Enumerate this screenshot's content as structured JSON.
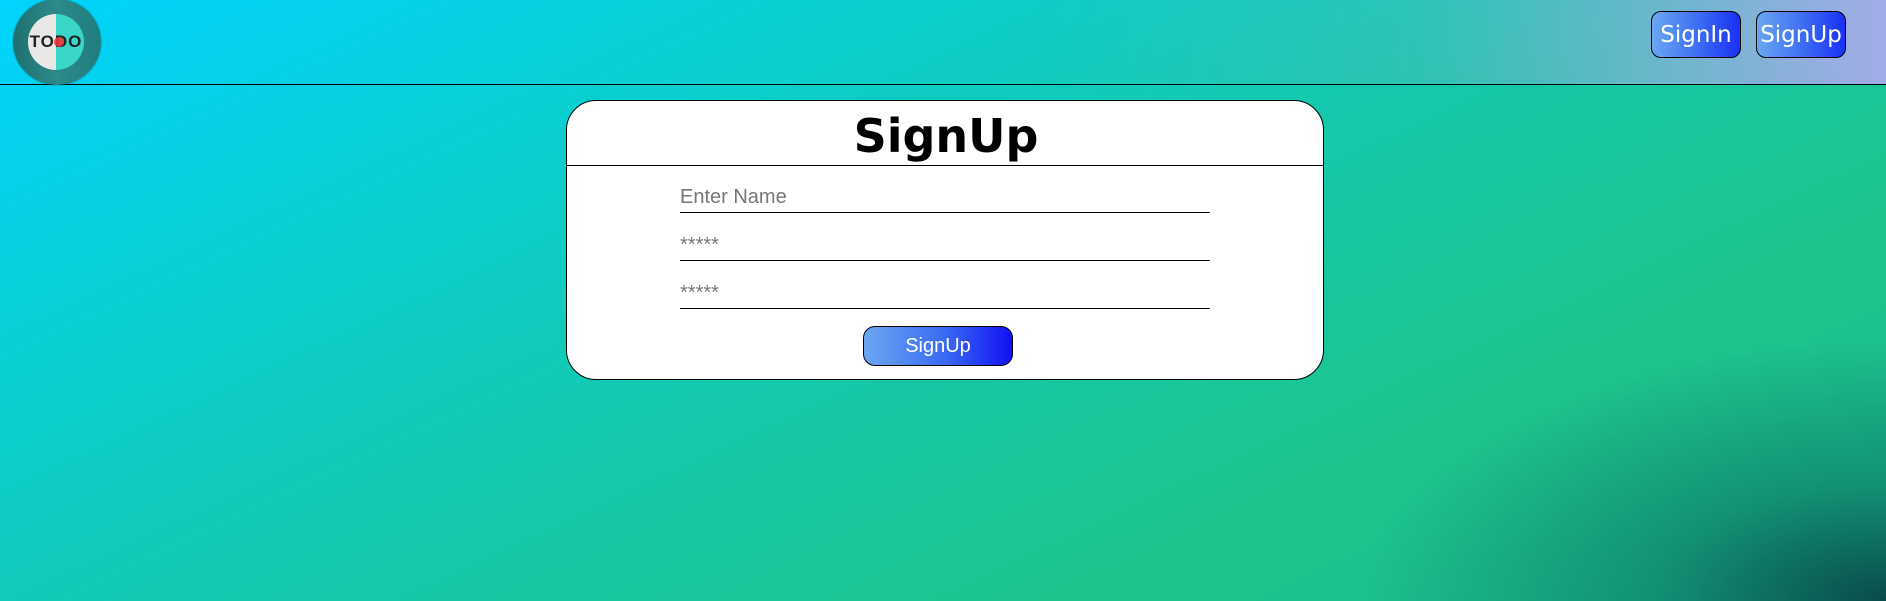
{
  "header": {
    "logo_text": "TODO",
    "signin_label": "SignIn",
    "signup_label": "SignUp"
  },
  "form": {
    "title": "SignUp",
    "name_placeholder": "Enter Name",
    "password_placeholder": "*****",
    "confirm_placeholder": "*****",
    "submit_label": "SignUp"
  },
  "colors": {
    "button_gradient_start": "#6aa7f2",
    "button_gradient_end": "#1010f5",
    "background_start": "#00d4ff",
    "background_mid": "#1ec48c"
  }
}
